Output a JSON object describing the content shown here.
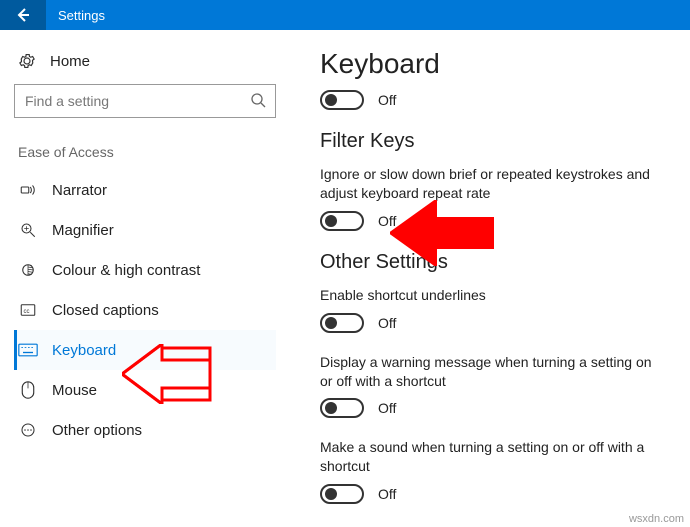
{
  "titlebar": {
    "app_title": "Settings"
  },
  "sidebar": {
    "home_label": "Home",
    "search_placeholder": "Find a setting",
    "group_heading": "Ease of Access",
    "items": [
      {
        "label": "Narrator"
      },
      {
        "label": "Magnifier"
      },
      {
        "label": "Colour & high contrast"
      },
      {
        "label": "Closed captions"
      },
      {
        "label": "Keyboard"
      },
      {
        "label": "Mouse"
      },
      {
        "label": "Other options"
      }
    ]
  },
  "main": {
    "page_title": "Keyboard",
    "toggle1_state": "Off",
    "section_filter": {
      "heading": "Filter Keys",
      "desc": "Ignore or slow down brief or repeated keystrokes and adjust keyboard repeat rate",
      "state": "Off"
    },
    "section_other": {
      "heading": "Other Settings",
      "items": [
        {
          "desc": "Enable shortcut underlines",
          "state": "Off"
        },
        {
          "desc": "Display a warning message when turning a setting on or off with a shortcut",
          "state": "Off"
        },
        {
          "desc": "Make a sound when turning a setting on or off with a shortcut",
          "state": "Off"
        }
      ]
    }
  },
  "watermark": "wsxdn.com"
}
